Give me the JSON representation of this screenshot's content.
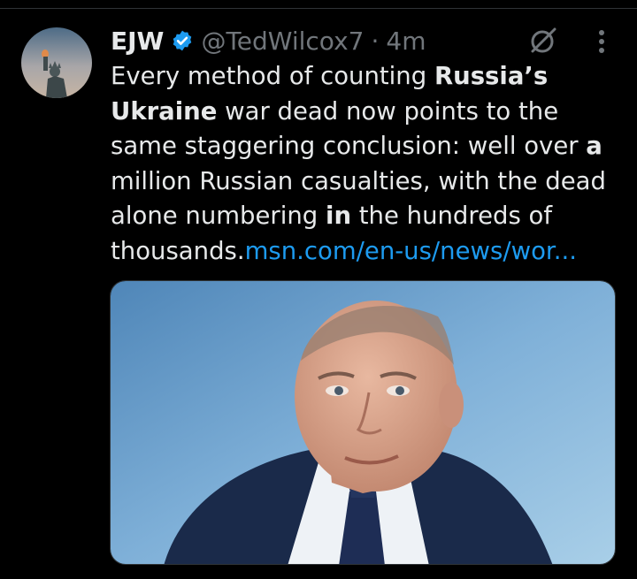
{
  "tweet": {
    "author_name": "EJW",
    "handle": "@TedWilcox7",
    "separator": "·",
    "time": "4m",
    "text_parts": {
      "p1": "Every method of counting ",
      "p2": "Russia’s",
      "p3": "Ukraine",
      "p4": " war dead now points to the",
      "p5": "same staggering conclusion: well over ",
      "p6": "a",
      "p7": "million Russian casualties, with the dead",
      "p8": "alone numbering ",
      "p9": "in",
      "p10": " the hundreds of",
      "p11": "thousands.",
      "link": "msn.com/en-us/news/wor..."
    },
    "colors": {
      "background": "#000000",
      "text": "#e7e9ea",
      "muted": "#71767b",
      "link": "#1d9bf0",
      "verified": "#1d9bf0"
    },
    "icons": {
      "verified": "verified-badge-icon",
      "grok": "grok-icon",
      "more": "more-vertical-icon"
    }
  }
}
